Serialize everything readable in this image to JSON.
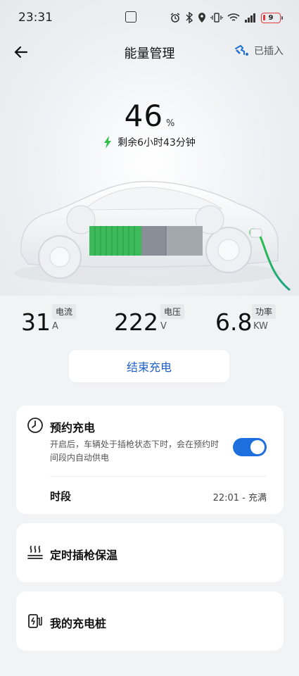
{
  "status_bar": {
    "time": "23:31",
    "battery_level": "9"
  },
  "header": {
    "title": "能量管理",
    "plug_status": "已插入"
  },
  "battery": {
    "percent": "46",
    "unit": "%",
    "remaining_time": "剩余6小时43分钟",
    "accent_color": "#2fbf4a"
  },
  "stats": [
    {
      "value": "31",
      "label": "电流",
      "unit": "A"
    },
    {
      "value": "222",
      "label": "电压",
      "unit": "V"
    },
    {
      "value": "6.8",
      "label": "功率",
      "unit": "KW"
    }
  ],
  "end_charge_button": "结束充电",
  "scheduled_charging": {
    "title": "预约充电",
    "description": "开启后，车辆处于插枪状态下时，会在预约时间段内自动供电",
    "enabled": true,
    "period_label": "时段",
    "period_value": "22:01 - 充满",
    "toggle_color": "#1d6fde"
  },
  "timed_heating": {
    "title": "定时插枪保温"
  },
  "my_charger": {
    "title": "我的充电桩"
  }
}
